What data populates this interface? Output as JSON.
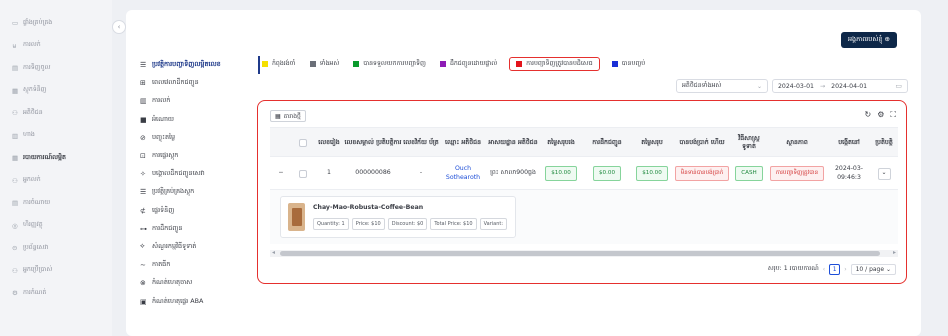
{
  "leftnav": {
    "items": [
      {
        "icon": "▭",
        "label": "ផ្ទាំងគ្រប់គ្រង"
      },
      {
        "icon": "⊌",
        "label": "ការលក់"
      },
      {
        "icon": "▤",
        "label": "ការទិញចូល"
      },
      {
        "icon": "▦",
        "label": "ស្តុកទំនិញ"
      },
      {
        "icon": "⚇",
        "label": "អតិថិជន"
      },
      {
        "icon": "▥",
        "label": "ហាង"
      },
      {
        "icon": "▦",
        "label": "របាយការណ៍លម្អិត",
        "active": true
      },
      {
        "icon": "⚇",
        "label": "អ្នកលក់"
      },
      {
        "icon": "▤",
        "label": "ការចំណាយ"
      },
      {
        "icon": "◎",
        "label": "ហិរញ្ញវត្ថុ"
      },
      {
        "icon": "⊝",
        "label": "ប្រព័ន្ធសេវា"
      },
      {
        "icon": "⚇",
        "label": "អ្នកប្រើប្រាស់"
      },
      {
        "icon": "⚙",
        "label": "ការកំណត់"
      }
    ]
  },
  "header": {
    "top_button": "អង្គភាពរបស់ខ្ញុំ ⊕"
  },
  "submenu": {
    "items": [
      {
        "icon": "☰",
        "label": "ប្រវត្តិការបញ្ជាទិញលម្អិតលេខ",
        "active": true
      },
      {
        "icon": "⊞",
        "label": "ពេលវេលាដឹកជញ្ជូន"
      },
      {
        "icon": "▥",
        "label": "ការលក់"
      },
      {
        "icon": "■",
        "label": "អំណោយ"
      },
      {
        "icon": "⊘",
        "label": "បញ្ចុះតម្លៃ"
      },
      {
        "icon": "⊡",
        "label": "ការផ្ទេរស្តុក"
      },
      {
        "icon": "✧",
        "label": "បង្គោលដឹកជញ្ជូនសេវា"
      },
      {
        "icon": "☰",
        "label": "ប្រវត្តិគ្រប់គ្រងស្តុក"
      },
      {
        "icon": "⊄",
        "label": "ផ្ទេរទំនិញ"
      },
      {
        "icon": "⊶",
        "label": "ការដឹកជញ្ជូន"
      },
      {
        "icon": "⟡",
        "label": "សំណួរកម្មវិធីទូទាត់"
      },
      {
        "icon": "∼",
        "label": "កាតធីក"
      },
      {
        "icon": "⊗",
        "label": "កំណត់ហេតុចាស"
      },
      {
        "icon": "▣",
        "label": "កំណត់ហេតុផ្ទេរ ABA"
      }
    ]
  },
  "legend": [
    {
      "label": "កំពុងរង់ចាំ",
      "color": "#f5e000"
    },
    {
      "label": "ទាំងអស់",
      "color": "#6b6f78"
    },
    {
      "label": "បានទទួលយកការបញ្ជាទិញ",
      "color": "#0a9a2c"
    },
    {
      "label": "ដឹកជញ្ជូនដោយផ្ទាល់",
      "color": "#8e1bb5"
    },
    {
      "label": "ការបញ្ជាទិញត្រូវបានបដិសេធ",
      "color": "#e3141b",
      "selected": true
    },
    {
      "label": "បានបញ្ចប់",
      "color": "#1a2fd6"
    }
  ],
  "filters": {
    "select_value": "អតិថិជនទាំងអស់",
    "date_from": "2024-03-01",
    "date_to": "2024-04-01"
  },
  "table": {
    "toolbar_label": "តារាងថ្មី",
    "columns": [
      "លេខរៀង",
      "លេខសម្គាល់ ប្រតិបត្តិការ",
      "លេខវិក័យ ប័ត្រ",
      "ឈ្មោះ អតិថិជន",
      "អាសយដ្ឋាន អតិថិជន",
      "តម្លៃសរុបរង",
      "ការដឹកជញ្ជូន",
      "តម្លៃសរុប",
      "បានបង់ប្រាក់ ហើយ",
      "វិធីសាស្ត្រ ទូទាត់",
      "ស្ថានភាព",
      "បង្កើតនៅ",
      "ប្រតិបត្តិ"
    ],
    "rows": [
      {
        "expand": "−",
        "index": "1",
        "txn_id": "000000086",
        "invoice": "-",
        "customer_first": "Ouch",
        "customer_last": "Sothearoth",
        "address": "ព្រះ សាលា900ធ្លង",
        "subtotal": "$10.00",
        "shipping": "$0.00",
        "total": "$10.00",
        "paid": "មិនទាន់បានបង់ប្រាក់",
        "method": "CASH",
        "status": "ការបញ្ជាទិញត្រូវបាន",
        "created_date": "2024-03-",
        "created_time": "09:46:3",
        "action": "⌄"
      }
    ],
    "product": {
      "name": "Chay-Mao-Robusta-Coffee-Bean",
      "quantity": "Quantity: 1",
      "price": "Price: $10",
      "discount": "Discount: $0",
      "total_price": "Total Price: $10",
      "variant": "Variant:"
    },
    "pager": {
      "summary": "សរុប: 1 របាយការណ៍",
      "current_page": "1",
      "page_size": "10 / page"
    }
  }
}
